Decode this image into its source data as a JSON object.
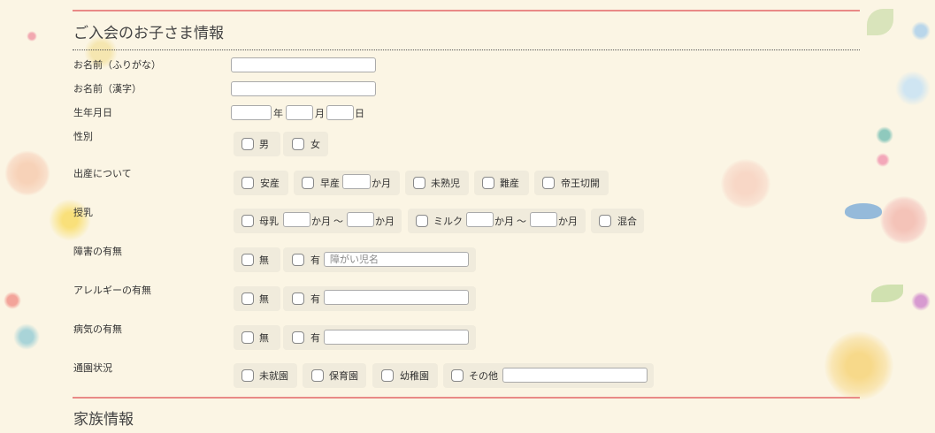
{
  "section1_title": "ご入会のお子さま情報",
  "section2_title": "家族情報",
  "rows": {
    "name_kana": {
      "label": "お名前（ふりがな）"
    },
    "name_kanji": {
      "label": "お名前（漢字）"
    },
    "birthdate": {
      "label": "生年月日",
      "year": "年",
      "month": "月",
      "day": "日"
    },
    "gender": {
      "label": "性別",
      "options": [
        "男",
        "女"
      ]
    },
    "birth": {
      "label": "出産について",
      "options": [
        "安産",
        "早産",
        "未熟児",
        "難産",
        "帝王切開"
      ],
      "unit": "か月"
    },
    "feeding": {
      "label": "授乳",
      "options": [
        "母乳",
        "ミルク",
        "混合"
      ],
      "unit": "か月",
      "tilde": "〜"
    },
    "disability": {
      "label": "障害の有無",
      "options": [
        "無",
        "有"
      ],
      "placeholder": "障がい児名"
    },
    "allergy": {
      "label": "アレルギーの有無",
      "options": [
        "無",
        "有"
      ]
    },
    "illness": {
      "label": "病気の有無",
      "options": [
        "無",
        "有"
      ]
    },
    "school": {
      "label": "通園状況",
      "options": [
        "未就園",
        "保育園",
        "幼稚園",
        "その他"
      ]
    }
  }
}
